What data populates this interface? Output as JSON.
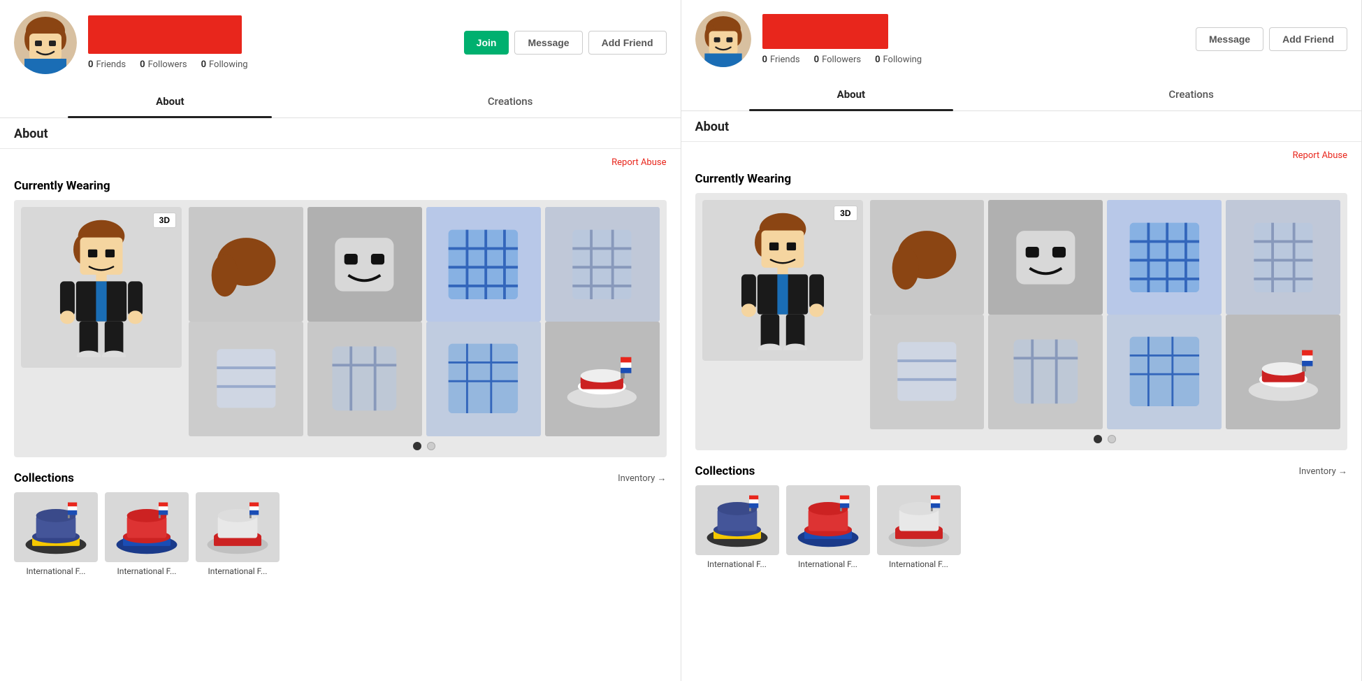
{
  "panels": [
    {
      "id": "left",
      "header": {
        "friends_label": "Friends",
        "friends_count": "0",
        "followers_label": "Followers",
        "followers_count": "0",
        "following_label": "Following",
        "following_count": "0",
        "join_label": "Join",
        "message_label": "Message",
        "add_friend_label": "Add Friend"
      },
      "tabs": [
        {
          "label": "About",
          "active": true
        },
        {
          "label": "Creations",
          "active": false
        }
      ],
      "about_title": "About",
      "report_label": "Report Abuse",
      "wearing_title": "Currently Wearing",
      "btn_3d": "3D",
      "dots": [
        {
          "active": true
        },
        {
          "active": false
        }
      ],
      "collections_title": "Collections",
      "inventory_label": "Inventory →",
      "collection_items": [
        {
          "label": "International F..."
        },
        {
          "label": "International F..."
        },
        {
          "label": "International F..."
        }
      ]
    },
    {
      "id": "right",
      "header": {
        "friends_label": "Friends",
        "friends_count": "0",
        "followers_label": "Followers",
        "followers_count": "0",
        "following_label": "Following",
        "following_count": "0",
        "message_label": "Message",
        "add_friend_label": "Add Friend"
      },
      "tabs": [
        {
          "label": "About",
          "active": true
        },
        {
          "label": "Creations",
          "active": false
        }
      ],
      "about_title": "About",
      "report_label": "Report Abuse",
      "wearing_title": "Currently Wearing",
      "btn_3d": "3D",
      "dots": [
        {
          "active": true
        },
        {
          "active": false
        }
      ],
      "collections_title": "Collections",
      "inventory_label": "Inventory →",
      "collection_items": [
        {
          "label": "International F..."
        },
        {
          "label": "International F..."
        },
        {
          "label": "International F..."
        }
      ]
    }
  ]
}
